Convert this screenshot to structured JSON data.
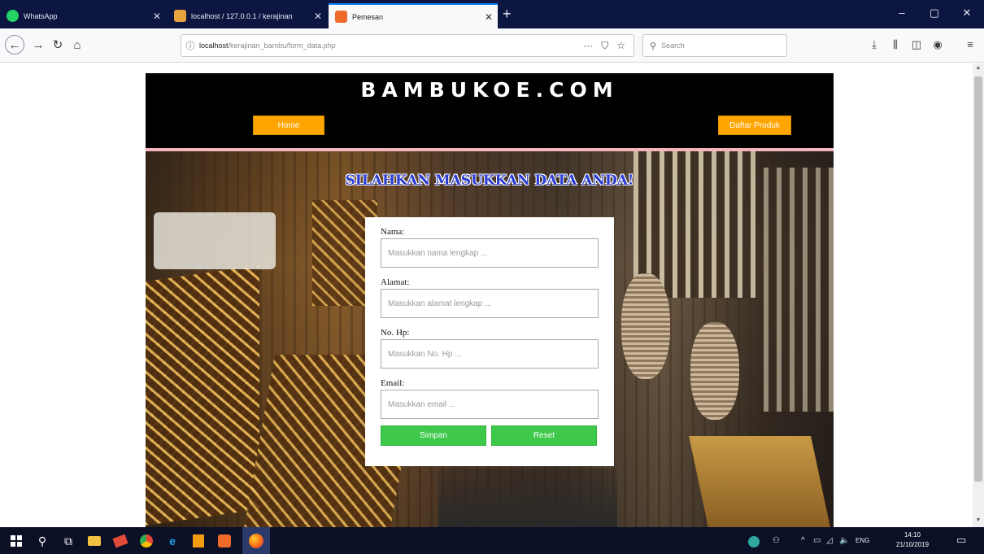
{
  "browser": {
    "tabs": [
      {
        "title": "WhatsApp",
        "icon": "whatsapp-icon",
        "color": "#25d366",
        "active": false
      },
      {
        "title": "localhost / 127.0.0.1 / kerajinan",
        "icon": "phpmyadmin-icon",
        "color": "#e8a33d",
        "active": false
      },
      {
        "title": "Pemesan",
        "icon": "page-icon",
        "color": "#f06a2a",
        "active": true
      }
    ],
    "new_tab_label": "+",
    "url_host": "localhost",
    "url_path": "/kerajinan_bambu/form_data.php",
    "search_placeholder": "Search",
    "window_controls": [
      "–",
      "▢",
      "✕"
    ]
  },
  "site": {
    "brand": "BAMBUKOE.COM",
    "nav_home": "Home",
    "nav_products": "Daftar Produk",
    "heading": "SILAHKAN MASUKKAN DATA ANDA!",
    "accent_color": "#ffa500",
    "button_color": "#3ec94a",
    "form": {
      "nama_label": "Nama:",
      "nama_placeholder": "Masukkan nama lengkap ...",
      "alamat_label": "Alamat:",
      "alamat_placeholder": "Masukkan alamat lengkap ...",
      "hp_label": "No. Hp:",
      "hp_placeholder": "Masukkan No. Hp ...",
      "email_label": "Email:",
      "email_placeholder": "Masukkan email ...",
      "submit_label": "Simpan",
      "reset_label": "Reset"
    }
  },
  "taskbar": {
    "language": "ENG",
    "time": "14:10",
    "date": "21/10/2019"
  }
}
